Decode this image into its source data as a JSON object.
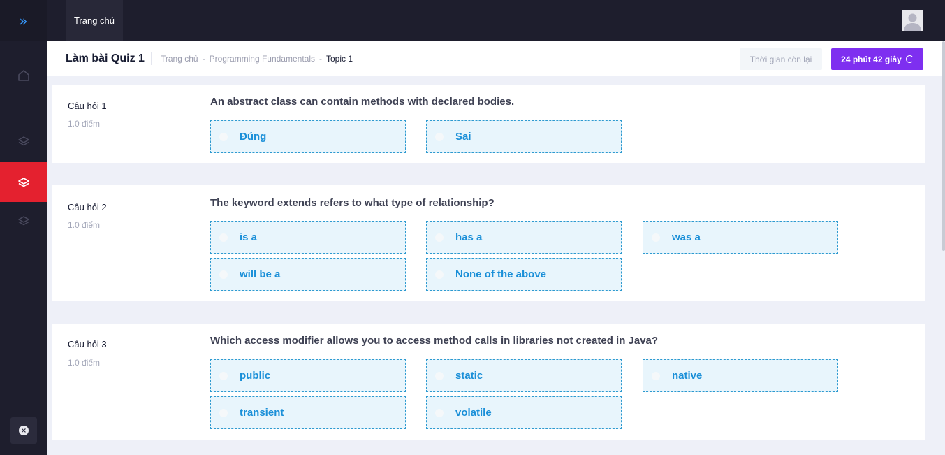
{
  "sidebar": {
    "toggle_icon": "»",
    "items": [
      {
        "icon": "home-icon"
      },
      {
        "icon": "layers-icon"
      },
      {
        "icon": "layers-icon",
        "active": true
      },
      {
        "icon": "layers-icon"
      }
    ],
    "close_icon": "×"
  },
  "topbar": {
    "tab_label": "Trang chủ"
  },
  "subheader": {
    "title": "Làm bài Quiz 1",
    "breadcrumb": [
      "Trang chủ",
      "-",
      "Programming Fundamentals",
      "-",
      "Topic 1"
    ],
    "time_label": "Thời gian còn lại",
    "timer": "24 phút 42 giây"
  },
  "questions": [
    {
      "label": "Câu hỏi 1",
      "points": "1.0 điểm",
      "text": "An abstract class can contain methods with declared bodies.",
      "options": [
        "Đúng",
        "Sai"
      ]
    },
    {
      "label": "Câu hỏi 2",
      "points": "1.0 điểm",
      "text": "The keyword extends refers to what type of relationship?",
      "options": [
        "is a",
        "has a",
        "was a",
        "will be a",
        "None of the above"
      ]
    },
    {
      "label": "Câu hỏi 3",
      "points": "1.0 điểm",
      "text": "Which access modifier allows you to access method calls in libraries not created in Java?",
      "options": [
        "public",
        "static",
        "native",
        "transient",
        "volatile"
      ]
    }
  ],
  "colors": {
    "accent": "#7e2ff0",
    "active_sidebar": "#e4212f",
    "option_text": "#1a8fd8"
  }
}
